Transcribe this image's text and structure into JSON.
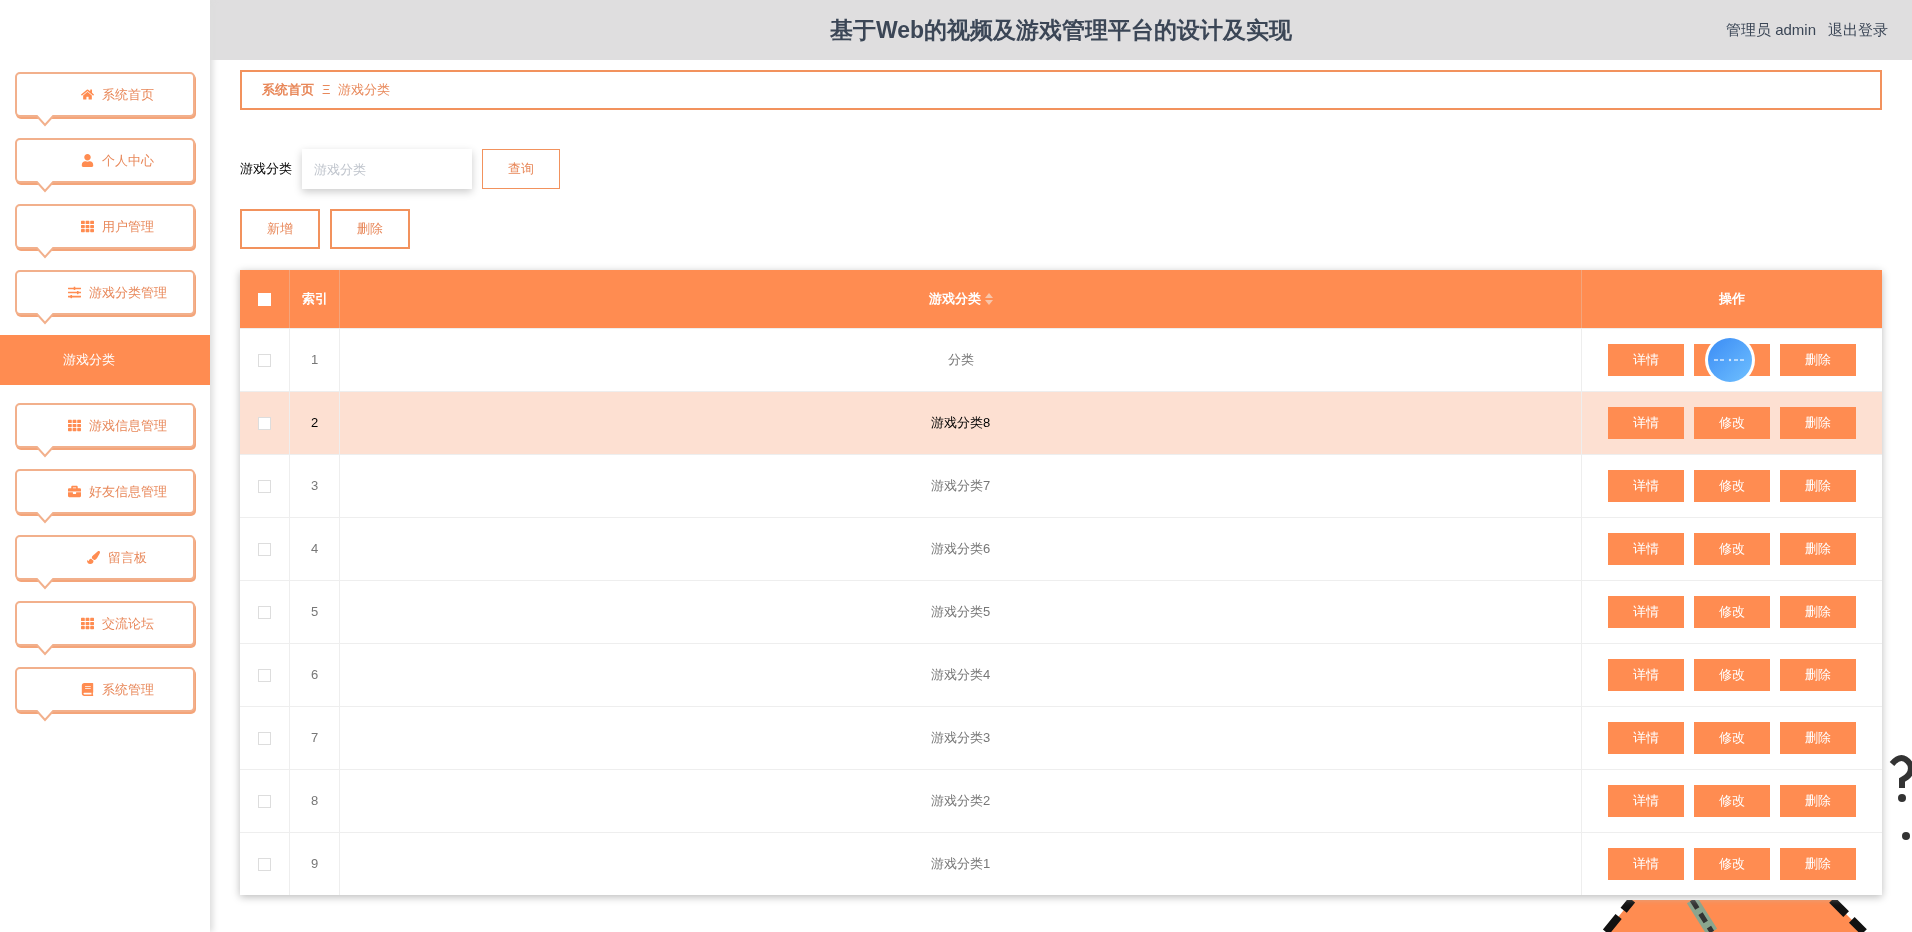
{
  "header": {
    "title": "基于Web的视频及游戏管理平台的设计及实现",
    "user": "管理员 admin",
    "logout": "退出登录"
  },
  "sidebar": {
    "items": [
      {
        "label": "系统首页",
        "selected": false
      },
      {
        "label": "个人中心",
        "selected": false
      },
      {
        "label": "用户管理",
        "selected": false
      },
      {
        "label": "游戏分类管理",
        "selected": false,
        "children": [
          {
            "label": "游戏分类",
            "selected": true
          }
        ]
      },
      {
        "label": "游戏信息管理",
        "selected": false
      },
      {
        "label": "好友信息管理",
        "selected": false
      },
      {
        "label": "留言板",
        "selected": false
      },
      {
        "label": "交流论坛",
        "selected": false
      },
      {
        "label": "系统管理",
        "selected": false
      }
    ]
  },
  "breadcrumb": {
    "items": [
      "系统首页",
      "游戏分类"
    ],
    "separator": "Ξ"
  },
  "search": {
    "label": "游戏分类",
    "placeholder": "游戏分类",
    "button": "查询"
  },
  "toolbar": [
    "新增",
    "删除"
  ],
  "table": {
    "all_selected": false,
    "columns": [
      "索引",
      "游戏分类",
      "操作"
    ],
    "rows": [
      {
        "index": "1",
        "name": "分类",
        "selected": false,
        "covered": true,
        "actions": [
          "详情",
          "删除"
        ]
      },
      {
        "index": "2",
        "name": "游戏分类8",
        "selected": true,
        "covered": false,
        "actions": [
          "详情",
          "修改",
          "删除"
        ]
      },
      {
        "index": "3",
        "name": "游戏分类7",
        "selected": false,
        "covered": false,
        "actions": [
          "详情",
          "修改",
          "删除"
        ]
      },
      {
        "index": "4",
        "name": "游戏分类6",
        "selected": false,
        "covered": false,
        "actions": [
          "详情",
          "修改",
          "删除"
        ]
      },
      {
        "index": "5",
        "name": "游戏分类5",
        "selected": false,
        "covered": false,
        "actions": [
          "详情",
          "修改",
          "删除"
        ]
      },
      {
        "index": "6",
        "name": "游戏分类4",
        "selected": false,
        "covered": false,
        "actions": [
          "详情",
          "修改",
          "删除"
        ]
      },
      {
        "index": "7",
        "name": "游戏分类3",
        "selected": false,
        "covered": false,
        "actions": [
          "详情",
          "修改",
          "删除"
        ]
      },
      {
        "index": "8",
        "name": "游戏分类2",
        "selected": false,
        "covered": false,
        "actions": [
          "详情",
          "修改",
          "删除"
        ]
      },
      {
        "index": "9",
        "name": "游戏分类1",
        "selected": false,
        "covered": false,
        "actions": [
          "详情",
          "修改",
          "删除"
        ]
      }
    ]
  }
}
